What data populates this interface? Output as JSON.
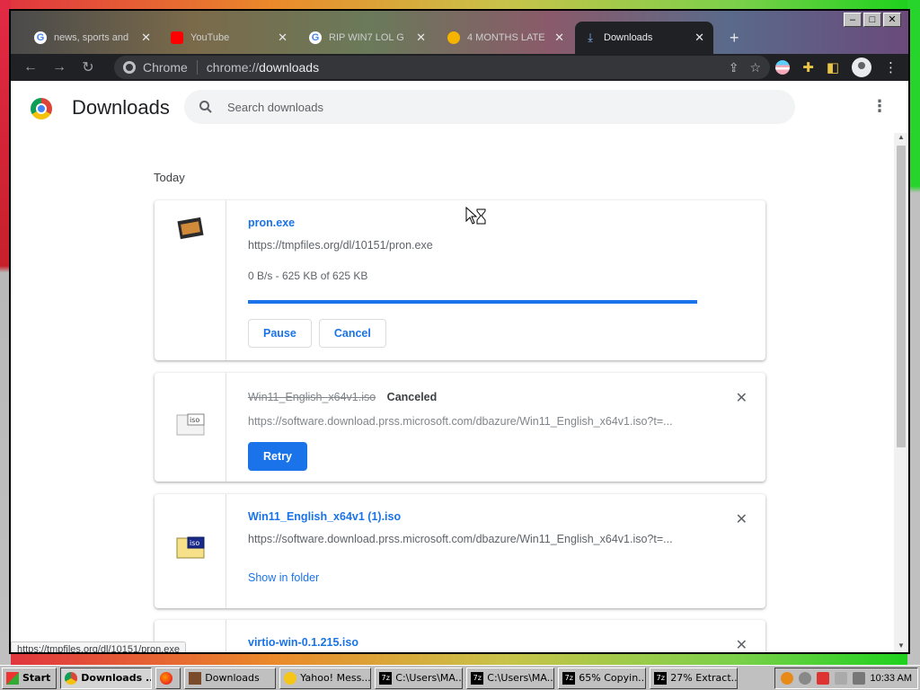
{
  "browser": {
    "tabs": [
      {
        "label": "news, sports and",
        "color": "#4285f4"
      },
      {
        "label": "YouTube",
        "color": "#ff0000"
      },
      {
        "label": "RIP WIN7 LOL G",
        "color": "#4285f4"
      },
      {
        "label": "4 MONTHS LATE",
        "color": "#f4b400"
      },
      {
        "label": "Downloads",
        "color": "#8ab4f8"
      }
    ],
    "new_tab": "+",
    "omnibox": {
      "scheme": "Chrome",
      "url_prefix": "chrome://",
      "url_host": "downloads"
    }
  },
  "page": {
    "title": "Downloads",
    "search_placeholder": "Search downloads",
    "section": "Today"
  },
  "downloads": [
    {
      "name": "pron.exe",
      "url": "https://tmpfiles.org/dl/10151/pron.exe",
      "status": "0 B/s - 625 KB of 625 KB",
      "progress": 1.0,
      "buttons": {
        "pause": "Pause",
        "cancel": "Cancel"
      }
    },
    {
      "name": "Win11_English_x64v1.iso",
      "state": "Canceled",
      "url": "https://software.download.prss.microsoft.com/dbazure/Win11_English_x64v1.iso?t=...",
      "button": "Retry"
    },
    {
      "name": "Win11_English_x64v1 (1).iso",
      "url": "https://software.download.prss.microsoft.com/dbazure/Win11_English_x64v1.iso?t=...",
      "link": "Show in folder"
    },
    {
      "name": "virtio-win-0.1.215.iso"
    }
  ],
  "status_tooltip": "https://tmpfiles.org/dl/10151/pron.exe",
  "taskbar": {
    "start": "Start",
    "items": [
      {
        "label": "Downloads ...",
        "active": true
      },
      {
        "label": "",
        "active": false
      },
      {
        "label": "Downloads",
        "active": false
      },
      {
        "label": "Yahoo! Mess...",
        "active": false
      },
      {
        "label": "C:\\Users\\MA...",
        "active": false
      },
      {
        "label": "C:\\Users\\MA...",
        "active": false
      },
      {
        "label": "65% Copyin...",
        "active": false
      },
      {
        "label": "27% Extract...",
        "active": false
      }
    ],
    "clock": "10:33 AM"
  },
  "colors": {
    "accent": "#1a73e8",
    "browser_frame": "#202124",
    "taskbar": "#c0c0c0"
  }
}
